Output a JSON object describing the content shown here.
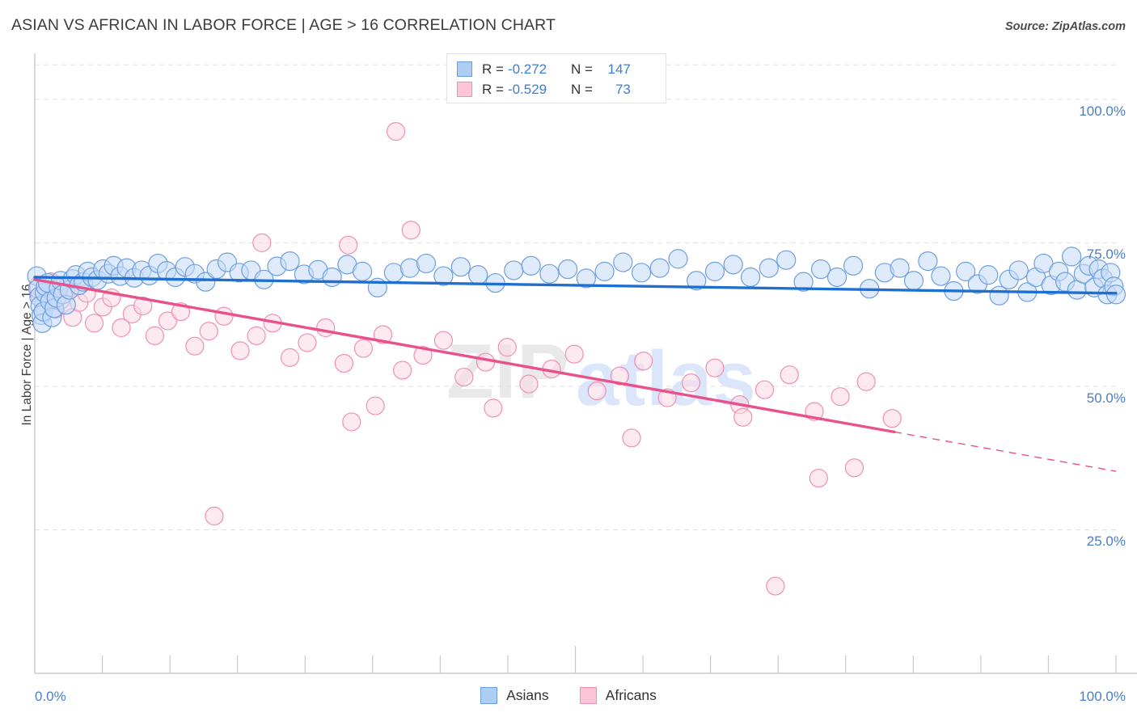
{
  "header": {
    "title": "ASIAN VS AFRICAN IN LABOR FORCE | AGE > 16 CORRELATION CHART",
    "source": "Source: ZipAtlas.com"
  },
  "watermark": {
    "part1": "ZIP",
    "part2": "atlas"
  },
  "stats": {
    "rows": [
      {
        "series": "Asians",
        "color": "#aecdf5",
        "r_label": "R =",
        "r_value": "-0.272",
        "n_label": "N =",
        "n_value": "147"
      },
      {
        "series": "Africans",
        "color": "#fbc4d7",
        "r_label": "R =",
        "r_value": "-0.529",
        "n_label": "N =",
        "n_value": "73"
      }
    ]
  },
  "legend": {
    "position": "bottom-center",
    "items": [
      {
        "label": "Asians",
        "color": "#aecdf5"
      },
      {
        "label": "Africans",
        "color": "#fbc4d7"
      }
    ]
  },
  "chart_data": {
    "type": "scatter",
    "title": "ASIAN VS AFRICAN IN LABOR FORCE | AGE > 16 CORRELATION CHART",
    "xlabel": "",
    "ylabel": "In Labor Force | Age > 16",
    "xlim": [
      0,
      100
    ],
    "ylim": [
      0,
      108
    ],
    "grid": true,
    "x_ticks": [
      "0.0%",
      "100.0%"
    ],
    "x_tick_values": [
      0,
      100
    ],
    "y_ticks": [
      "25.0%",
      "50.0%",
      "75.0%",
      "100.0%"
    ],
    "y_tick_values": [
      25,
      50,
      75,
      100
    ],
    "colors": {
      "asian_fill": "#c5dbf7",
      "asian_stroke": "#6d9fe0",
      "asian_line": "#1f6fd0",
      "african_fill": "#fbd9e6",
      "african_stroke": "#ef8fb2",
      "african_line": "#e8518a",
      "tick_text": "#4a7ec4",
      "gridline": "#e0e0e0"
    },
    "series": [
      {
        "name": "Asians",
        "r": -0.272,
        "n": 147,
        "trend": {
          "x0": 0,
          "y0": 69.0,
          "x1": 100,
          "y1": 66.2,
          "dashed_from": 100
        },
        "points": [
          [
            0.2,
            69.2
          ],
          [
            0.3,
            67.0
          ],
          [
            0.4,
            65.6
          ],
          [
            0.5,
            64.0
          ],
          [
            0.6,
            62.4
          ],
          [
            0.7,
            61.0
          ],
          [
            0.8,
            63.0
          ],
          [
            0.9,
            66.3
          ],
          [
            1.0,
            67.4
          ],
          [
            1.2,
            68.0
          ],
          [
            1.4,
            64.8
          ],
          [
            1.6,
            62.0
          ],
          [
            1.8,
            63.6
          ],
          [
            2.0,
            65.4
          ],
          [
            2.2,
            67.1
          ],
          [
            2.4,
            68.4
          ],
          [
            2.6,
            66.0
          ],
          [
            2.9,
            64.2
          ],
          [
            3.2,
            66.8
          ],
          [
            3.5,
            68.7
          ],
          [
            3.8,
            69.4
          ],
          [
            4.1,
            67.6
          ],
          [
            4.5,
            68.2
          ],
          [
            4.9,
            70.0
          ],
          [
            5.3,
            69.0
          ],
          [
            5.8,
            68.5
          ],
          [
            6.3,
            70.4
          ],
          [
            6.8,
            69.6
          ],
          [
            7.3,
            71.0
          ],
          [
            7.9,
            69.2
          ],
          [
            8.5,
            70.6
          ],
          [
            9.2,
            68.9
          ],
          [
            9.9,
            70.2
          ],
          [
            10.6,
            69.3
          ],
          [
            11.4,
            71.4
          ],
          [
            12.2,
            70.1
          ],
          [
            13.0,
            69.0
          ],
          [
            13.9,
            70.8
          ],
          [
            14.8,
            69.6
          ],
          [
            15.8,
            68.2
          ],
          [
            16.8,
            70.4
          ],
          [
            17.8,
            71.6
          ],
          [
            18.9,
            69.8
          ],
          [
            20.0,
            70.2
          ],
          [
            21.2,
            68.6
          ],
          [
            22.4,
            70.9
          ],
          [
            23.6,
            71.8
          ],
          [
            24.9,
            69.5
          ],
          [
            26.2,
            70.3
          ],
          [
            27.5,
            69.0
          ],
          [
            28.9,
            71.2
          ],
          [
            30.3,
            70.0
          ],
          [
            31.7,
            67.2
          ],
          [
            33.2,
            69.8
          ],
          [
            34.7,
            70.6
          ],
          [
            36.2,
            71.4
          ],
          [
            37.8,
            69.2
          ],
          [
            39.4,
            70.8
          ],
          [
            41.0,
            69.4
          ],
          [
            42.6,
            68.0
          ],
          [
            44.3,
            70.2
          ],
          [
            45.9,
            71.0
          ],
          [
            47.6,
            69.6
          ],
          [
            49.3,
            70.4
          ],
          [
            51.0,
            68.8
          ],
          [
            52.7,
            70.0
          ],
          [
            54.4,
            71.6
          ],
          [
            56.1,
            69.8
          ],
          [
            57.8,
            70.6
          ],
          [
            59.5,
            72.2
          ],
          [
            61.2,
            68.4
          ],
          [
            62.9,
            70.0
          ],
          [
            64.6,
            71.2
          ],
          [
            66.2,
            69.0
          ],
          [
            67.9,
            70.6
          ],
          [
            69.5,
            72.0
          ],
          [
            71.1,
            68.2
          ],
          [
            72.7,
            70.4
          ],
          [
            74.2,
            69.0
          ],
          [
            75.7,
            71.0
          ],
          [
            77.2,
            67.0
          ],
          [
            78.6,
            69.8
          ],
          [
            80.0,
            70.6
          ],
          [
            81.3,
            68.4
          ],
          [
            82.6,
            71.8
          ],
          [
            83.8,
            69.2
          ],
          [
            85.0,
            66.6
          ],
          [
            86.1,
            70.0
          ],
          [
            87.2,
            67.8
          ],
          [
            88.2,
            69.4
          ],
          [
            89.2,
            65.8
          ],
          [
            90.1,
            68.6
          ],
          [
            91.0,
            70.2
          ],
          [
            91.8,
            66.4
          ],
          [
            92.6,
            69.0
          ],
          [
            93.3,
            71.4
          ],
          [
            94.0,
            67.6
          ],
          [
            94.7,
            70.0
          ],
          [
            95.3,
            68.2
          ],
          [
            95.9,
            72.6
          ],
          [
            96.4,
            66.8
          ],
          [
            97.0,
            69.6
          ],
          [
            97.5,
            71.0
          ],
          [
            98.0,
            67.2
          ],
          [
            98.4,
            70.4
          ],
          [
            98.8,
            68.8
          ],
          [
            99.2,
            66.0
          ],
          [
            99.5,
            69.8
          ],
          [
            99.8,
            67.4
          ],
          [
            100.0,
            66.0
          ]
        ]
      },
      {
        "name": "Africans",
        "r": -0.529,
        "n": 73,
        "trend": {
          "x0": 0,
          "y0": 68.6,
          "x1": 100,
          "y1": 35.2,
          "dashed_from": 79.5
        },
        "points": [
          [
            0.3,
            67.5
          ],
          [
            0.5,
            65.8
          ],
          [
            0.8,
            64.0
          ],
          [
            1.1,
            66.8
          ],
          [
            1.5,
            68.2
          ],
          [
            1.9,
            63.4
          ],
          [
            2.4,
            65.0
          ],
          [
            2.9,
            67.0
          ],
          [
            3.5,
            62.0
          ],
          [
            4.1,
            64.6
          ],
          [
            4.8,
            66.2
          ],
          [
            5.5,
            61.0
          ],
          [
            6.3,
            63.8
          ],
          [
            7.1,
            65.4
          ],
          [
            8.0,
            60.2
          ],
          [
            9.0,
            62.6
          ],
          [
            10.0,
            64.0
          ],
          [
            11.1,
            58.8
          ],
          [
            12.3,
            61.4
          ],
          [
            13.5,
            63.0
          ],
          [
            14.8,
            57.0
          ],
          [
            16.1,
            59.6
          ],
          [
            17.5,
            62.2
          ],
          [
            19.0,
            56.2
          ],
          [
            20.5,
            58.8
          ],
          [
            22.0,
            61.0
          ],
          [
            23.6,
            55.0
          ],
          [
            25.2,
            57.6
          ],
          [
            26.9,
            60.2
          ],
          [
            28.6,
            54.0
          ],
          [
            30.4,
            56.6
          ],
          [
            32.2,
            59.0
          ],
          [
            34.0,
            52.8
          ],
          [
            35.9,
            55.4
          ],
          [
            37.8,
            58.0
          ],
          [
            39.7,
            51.6
          ],
          [
            41.7,
            54.2
          ],
          [
            43.7,
            56.8
          ],
          [
            45.7,
            50.4
          ],
          [
            47.8,
            53.0
          ],
          [
            49.9,
            55.6
          ],
          [
            52.0,
            49.2
          ],
          [
            54.1,
            51.8
          ],
          [
            56.3,
            54.4
          ],
          [
            58.5,
            48.0
          ],
          [
            60.7,
            50.6
          ],
          [
            62.9,
            53.2
          ],
          [
            65.2,
            46.8
          ],
          [
            67.5,
            49.4
          ],
          [
            69.8,
            52.0
          ],
          [
            72.1,
            45.6
          ],
          [
            74.5,
            48.2
          ],
          [
            76.9,
            50.8
          ],
          [
            79.3,
            44.4
          ]
        ],
        "outliers": [
          [
            33.4,
            94.4
          ],
          [
            34.8,
            77.2
          ],
          [
            29.0,
            74.6
          ],
          [
            21.0,
            75.0
          ],
          [
            31.5,
            46.6
          ],
          [
            29.3,
            43.8
          ],
          [
            42.4,
            46.2
          ],
          [
            65.5,
            44.6
          ],
          [
            55.2,
            41.0
          ],
          [
            72.5,
            34.0
          ],
          [
            75.8,
            35.8
          ],
          [
            16.6,
            27.4
          ],
          [
            68.5,
            15.2
          ]
        ]
      }
    ]
  }
}
